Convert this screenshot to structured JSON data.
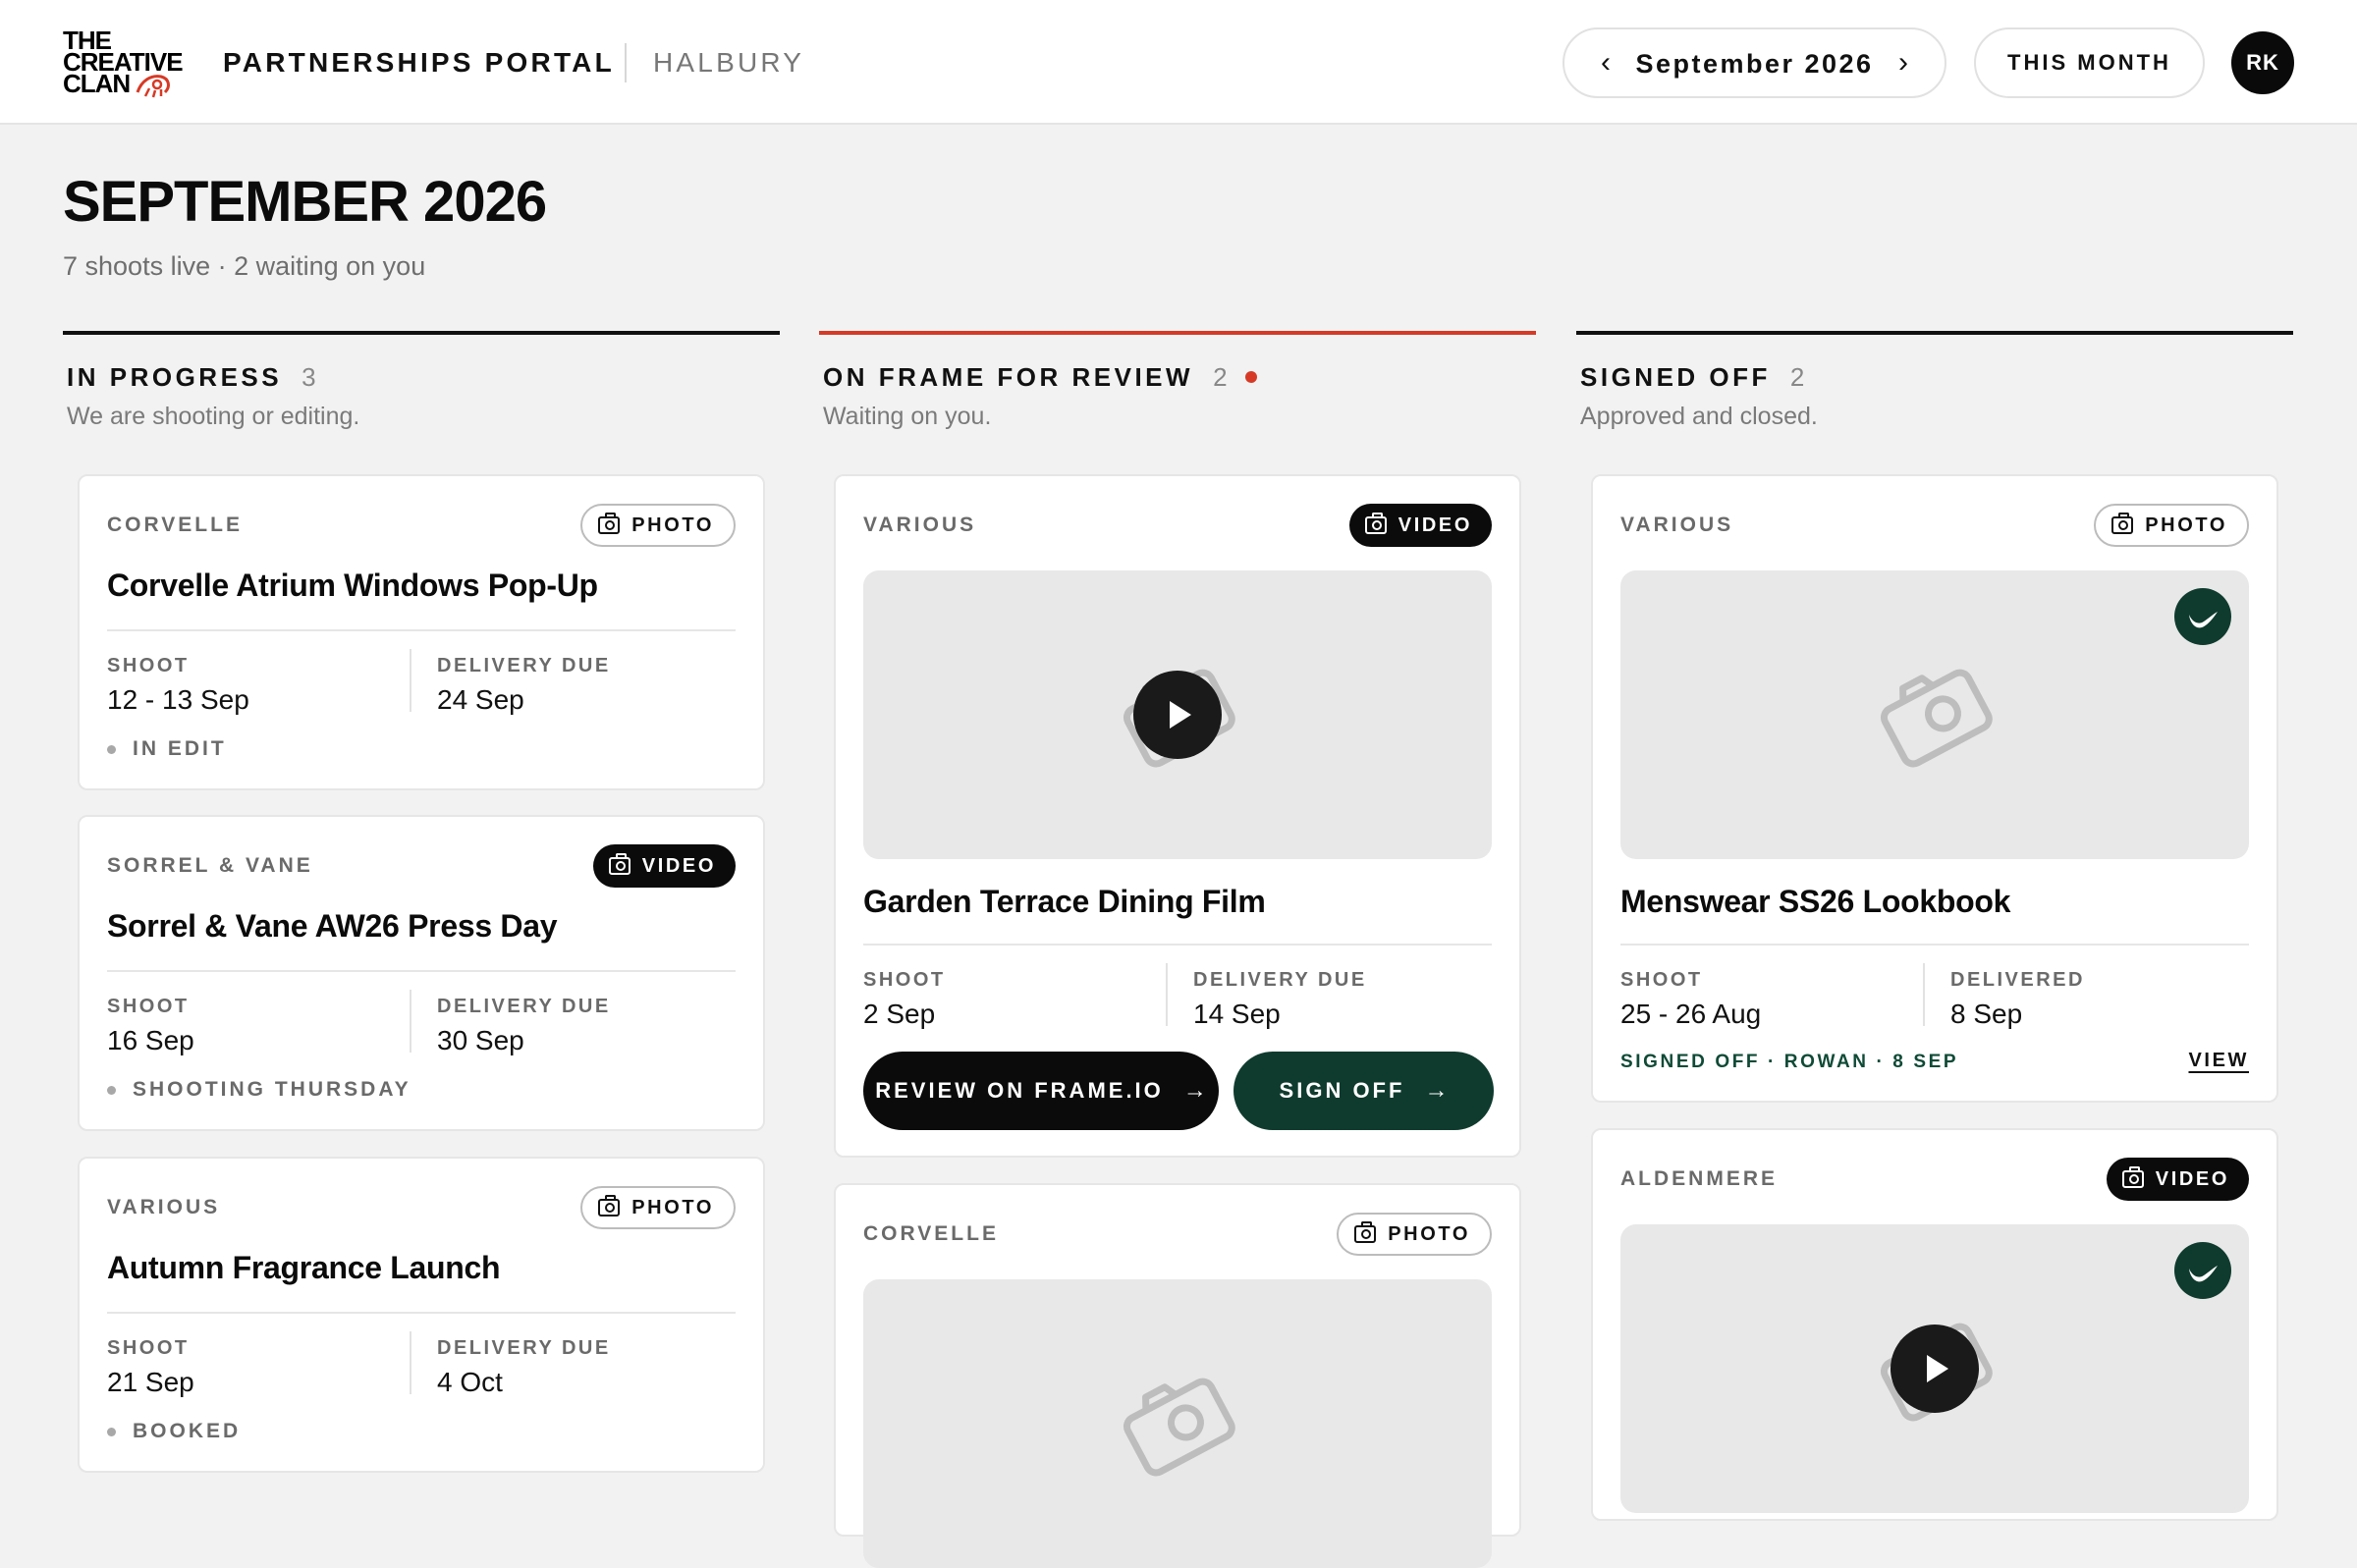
{
  "header": {
    "logo_lines": [
      "THE",
      "CREATIVE",
      "CLAN"
    ],
    "portal_title": "PARTNERSHIPS PORTAL",
    "client": "HALBURY",
    "month": "September 2026",
    "prev_icon": "chevron-left-icon",
    "next_icon": "chevron-right-icon",
    "this_month": "THIS MONTH",
    "avatar_initials": "RK"
  },
  "page": {
    "title": "SEPTEMBER 2026",
    "subtitle": "7 shoots live · 2 waiting on you"
  },
  "colors": {
    "accent_red": "#d63a26",
    "signed_green": "#0f3b2e",
    "black": "#0b0b0b"
  },
  "columns": [
    {
      "title": "IN PROGRESS",
      "count": "3",
      "description": "We are shooting or editing.",
      "cards": [
        {
          "brand": "CORVELLE",
          "tag": "PHOTO",
          "title": "Corvelle Atrium Windows Pop-Up",
          "shoot_label": "SHOOT",
          "shoot": "12 - 13 Sep",
          "delivery_label": "DELIVERY DUE",
          "delivery": "24 Sep",
          "status": "IN EDIT"
        },
        {
          "brand": "SORREL & VANE",
          "tag": "VIDEO",
          "title": "Sorrel & Vane AW26 Press Day",
          "shoot_label": "SHOOT",
          "shoot": "16 Sep",
          "delivery_label": "DELIVERY DUE",
          "delivery": "30 Sep",
          "status": "SHOOTING THURSDAY"
        },
        {
          "brand": "VARIOUS",
          "tag": "PHOTO",
          "title": "Autumn Fragrance Launch",
          "shoot_label": "SHOOT",
          "shoot": "21 Sep",
          "delivery_label": "DELIVERY DUE",
          "delivery": "4 Oct",
          "status": "BOOKED"
        }
      ]
    },
    {
      "title": "ON FRAME FOR REVIEW",
      "count": "2",
      "description": "Waiting on you.",
      "cards": [
        {
          "brand": "VARIOUS",
          "tag": "VIDEO",
          "title": "Garden Terrace Dining Film",
          "shoot_label": "SHOOT",
          "shoot": "2 Sep",
          "delivery_label": "DELIVERY DUE",
          "delivery": "14 Sep",
          "review_button": "REVIEW ON FRAME.IO",
          "signoff_button": "SIGN OFF"
        },
        {
          "brand": "CORVELLE",
          "tag": "PHOTO"
        }
      ]
    },
    {
      "title": "SIGNED OFF",
      "count": "2",
      "description": "Approved and closed.",
      "cards": [
        {
          "brand": "VARIOUS",
          "tag": "PHOTO",
          "title": "Menswear SS26 Lookbook",
          "shoot_label": "SHOOT",
          "shoot": "25 - 26 Aug",
          "delivery_label": "DELIVERED",
          "delivery": "8 Sep",
          "signed_note": "SIGNED OFF · ROWAN · 8 SEP",
          "view_link": "VIEW"
        },
        {
          "brand": "ALDENMERE",
          "tag": "VIDEO"
        }
      ]
    }
  ]
}
